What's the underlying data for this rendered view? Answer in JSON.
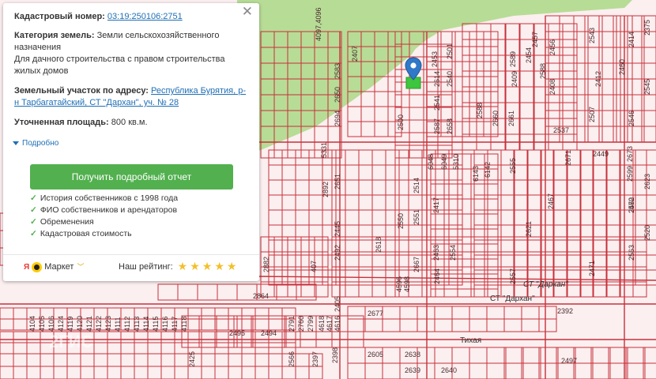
{
  "card": {
    "cadastral_label": "Кадастровый номер:",
    "cadastral_number": "03:19:250106:2751",
    "land_category_label": "Категория земель:",
    "land_category_value": "Земли сельскохозяйственного назначения",
    "permitted_use": "Для дачного строительства с правом строительства жилых домов",
    "address_label": "Земельный участок по адресу:",
    "address_value": "Республика Бурятия, р-н Тарбагатайский, СТ \"Дархан\", уч. № 28",
    "area_label": "Уточненная площадь:",
    "area_value": "800 кв.м.",
    "more_label": "Подробно",
    "report_button": "Получить подробный отчет",
    "features": [
      "История собственников с 1998 года",
      "ФИО собственников и арендаторов",
      "Обременения",
      "Кадастровая стоимость"
    ],
    "market_ya": "Я",
    "market_label": "Маркет",
    "rating_label": "Наш рейтинг:",
    "rating_stars": 5,
    "close_glyph": "✕"
  },
  "map": {
    "colors": {
      "background": "#fbeff0",
      "green_area": "#b7dc96",
      "parcel_border": "#c7313a",
      "selected_parcel": "#3ec63e",
      "pin": "#2f79c8"
    },
    "street_labels": [
      "СТ \"Дархан\"",
      "СТ \"Даркан\"",
      "Тихая"
    ],
    "watermark": "2ГИС",
    "plot_numbers": [
      "2407",
      "4097,4096",
      "2583",
      "2650",
      "2694",
      "2453",
      "2501",
      "2614",
      "2540",
      "2541",
      "2588",
      "2587",
      "2658",
      "2660",
      "2661",
      "2589",
      "2454",
      "2409",
      "2456",
      "2408",
      "2543",
      "2412",
      "2414",
      "2375",
      "2588",
      "2457",
      "2537",
      "2507",
      "2546",
      "2545",
      "2460",
      "2500",
      "5331",
      "6048",
      "6049",
      "5310",
      "6143",
      "6142",
      "2449",
      "2673",
      "2555",
      "2671",
      "2599",
      "2560",
      "2623",
      "2472",
      "2514",
      "2651",
      "2892",
      "2417",
      "2520",
      "2563",
      "2467",
      "2550",
      "2551",
      "2618",
      "2445",
      "2492",
      "2463",
      "2554",
      "2464",
      "2621",
      "2557",
      "2471",
      "2667",
      "4596",
      "4598",
      "2882",
      "407",
      "2864",
      "2495",
      "2494",
      "2405",
      "2677",
      "2392",
      "2605",
      "2638",
      "2639",
      "2640",
      "2497",
      "2425",
      "2566",
      "2397",
      "2398",
      "4104",
      "4105",
      "4106",
      "4124",
      "4119",
      "4120",
      "4121",
      "4122",
      "4123",
      "4111",
      "4112",
      "4113",
      "4114",
      "4115",
      "4116",
      "4117",
      "4118",
      "4618",
      "4617",
      "4616",
      "2791",
      "2760",
      "2799"
    ]
  }
}
